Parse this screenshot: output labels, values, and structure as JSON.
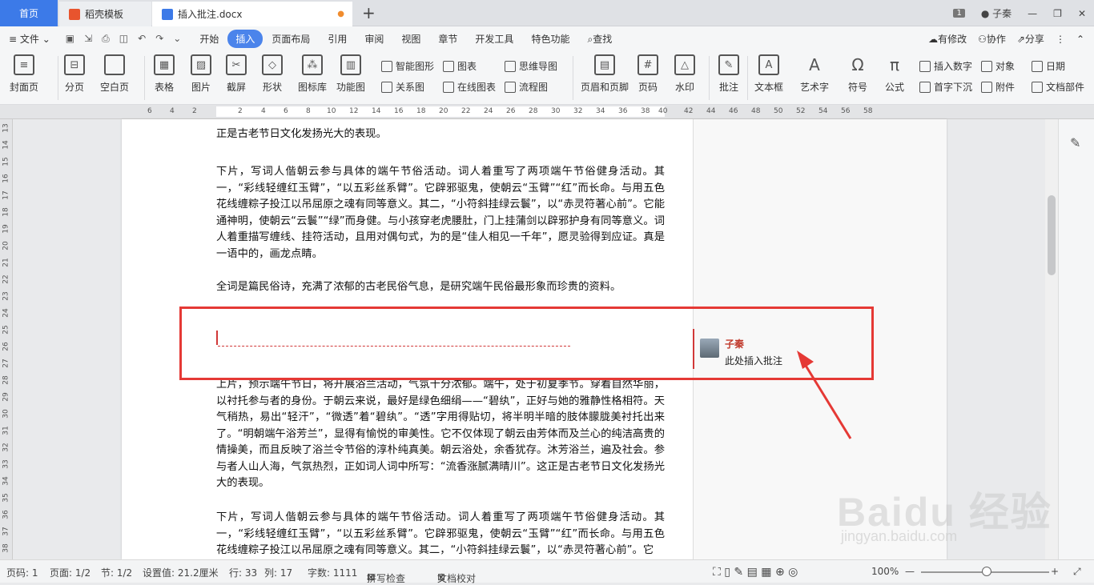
{
  "tabs": {
    "home": "首页",
    "template": "稻壳模板",
    "doc": "插入批注.docx",
    "add": "+"
  },
  "window": {
    "badge": "1",
    "user": "子秦"
  },
  "menu": {
    "file": "文件",
    "items": [
      "开始",
      "插入",
      "页面布局",
      "引用",
      "审阅",
      "视图",
      "章节",
      "开发工具",
      "特色功能"
    ],
    "active": "插入",
    "search": "查找",
    "right": [
      "有修改",
      "协作",
      "分享"
    ]
  },
  "ribbon": {
    "big": [
      "封面页",
      "分页",
      "空白页",
      "表格",
      "图片",
      "截屏",
      "形状",
      "图标库",
      "功能图",
      "页眉和页脚",
      "页码",
      "水印",
      "批注",
      "文本框",
      "艺术字",
      "符号",
      "公式"
    ],
    "small": [
      "智能图形",
      "图表",
      "思维导图",
      "关系图",
      "在线图表",
      "流程图",
      "插入数字",
      "对象",
      "日期",
      "首字下沉",
      "附件",
      "文档部件"
    ]
  },
  "ruler": {
    "h": [
      "6",
      "4",
      "2",
      "2",
      "4",
      "6",
      "8",
      "10",
      "12",
      "14",
      "16",
      "18",
      "20",
      "22",
      "24",
      "26",
      "28",
      "30",
      "32",
      "34",
      "36",
      "38",
      "40",
      "42",
      "44",
      "46",
      "48",
      "50",
      "52",
      "54",
      "56",
      "58"
    ],
    "v": [
      "13",
      "14",
      "15",
      "16",
      "17",
      "18",
      "19",
      "20",
      "21",
      "22",
      "23",
      "24",
      "25",
      "26",
      "27",
      "28",
      "29",
      "30",
      "31",
      "32",
      "33",
      "34",
      "35",
      "36",
      "37",
      "38"
    ]
  },
  "document": {
    "cut_top": "正是古老节日文化发扬光大的表现。",
    "p1": "下片，写词人偕朝云参与具体的端午节俗活动。词人着重写了两项端午节俗健身活动。其一，“彩线轻缠红玉臂”，“以五彩丝系臂”。它辟邪驱鬼，使朝云“玉臂”“红”而长命。与用五色花线缠粽子投江以吊屈原之魂有同等意义。其二，“小符斜挂绿云鬟”，以“赤灵符著心前”。它能通神明，使朝云“云鬟”“绿”而身健。与小孩穿老虎腰肚，门上挂蒲剑以辟邪护身有同等意义。词人着重描写缠线、挂符活动，且用对偶句式，为的是“佳人相见一千年”，愿灵验得到应证。真是一语中的，画龙点睛。",
    "p2": "全词是篇民俗诗，充满了浓郁的古老民俗气息，是研究端午民俗最形象而珍贵的资料。",
    "p3": "上片，预示端午节日，将开展浴兰活动，气氛十分浓郁。端午，处于初夏季节。穿着自然华丽，以衬托参与者的身份。于朝云来说，最好是绿色细绢——“碧纨”，正好与她的雅静性格相符。天气稍热，易出“轻汗”，“微透”着“碧纨”。“透”字用得贴切，将半明半暗的肢体朦胧美衬托出来了。“明朝端午浴芳兰”，显得有愉悦的审美性。它不仅体现了朝云由芳体而及兰心的纯洁高贵的情操美，而且反映了浴兰令节俗的淳朴纯真美。朝云浴处，余香犹存。沐芳浴兰，遍及社会。参与者人山人海，气氛热烈，正如词人词中所写：“流香涨腻满晴川”。这正是古老节日文化发扬光大的表现。",
    "p4": "下片，写词人偕朝云参与具体的端午节俗活动。词人着重写了两项端午节俗健身活动。其一，“彩线轻缠红玉臂”，“以五彩丝系臂”。它辟邪驱鬼，使朝云“玉臂”“红”而长命。与用五色花线缠粽子投江以吊屈原之魂有同等意义。其二，“小符斜挂绿云鬟”，以“赤灵符著心前”。它"
  },
  "comment": {
    "author": "子秦",
    "text": "此处插入批注"
  },
  "status": {
    "page_num": "页码: 1",
    "pages": "页面: 1/2",
    "section": "节: 1/2",
    "setting": "设置值: 21.2厘米",
    "row": "行: 33",
    "col": "列: 17",
    "words": "字数: 1111",
    "spell": "拼写检查",
    "proof": "文档校对",
    "zoom": "100%"
  },
  "watermark": {
    "brand": "Baidu 经验",
    "url": "jingyan.baidu.com"
  },
  "colors": {
    "accent": "#4b84eb",
    "highlight": "#e53935",
    "comment": "#d13838"
  }
}
